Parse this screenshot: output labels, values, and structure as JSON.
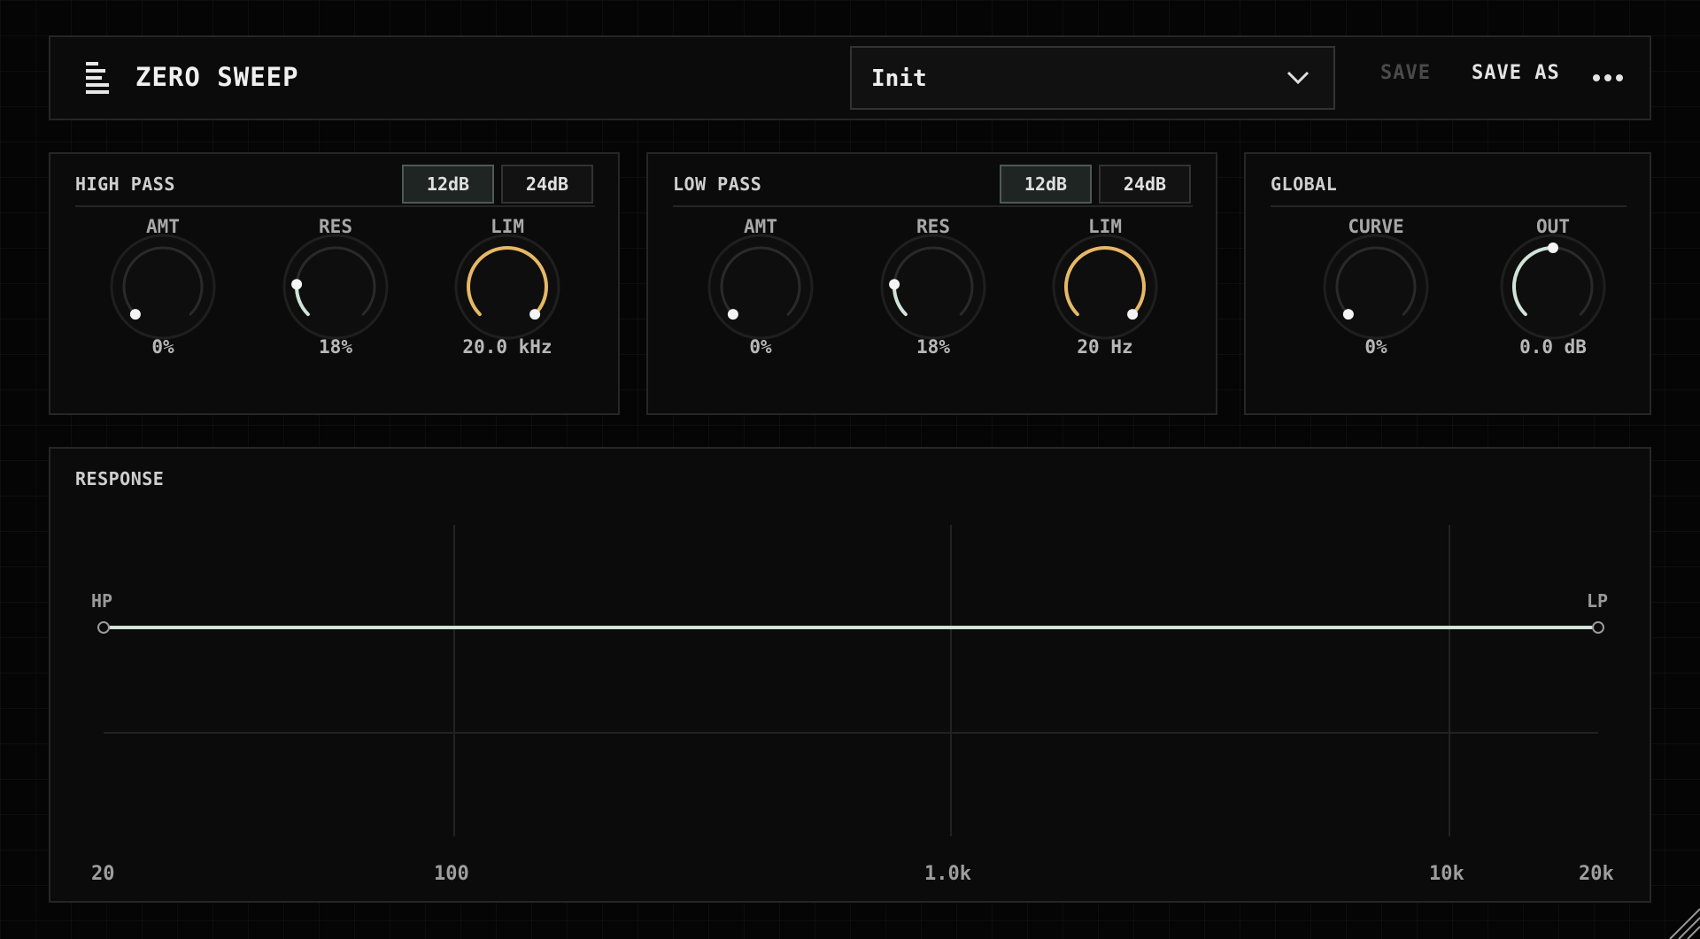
{
  "app": {
    "title": "ZERO SWEEP"
  },
  "header": {
    "preset_name": "Init",
    "save_label": "SAVE",
    "save_as_label": "SAVE AS"
  },
  "high_pass": {
    "title": "HIGH PASS",
    "slope_options": [
      "12dB",
      "24dB"
    ],
    "selected_slope": "12dB",
    "knobs": {
      "amt": {
        "label": "AMT",
        "value": "0%",
        "level": 0.0
      },
      "res": {
        "label": "RES",
        "value": "18%",
        "level": 0.18
      },
      "lim": {
        "label": "LIM",
        "value": "20.0 kHz",
        "level": 1.0
      }
    }
  },
  "low_pass": {
    "title": "LOW PASS",
    "slope_options": [
      "12dB",
      "24dB"
    ],
    "selected_slope": "12dB",
    "knobs": {
      "amt": {
        "label": "AMT",
        "value": "0%",
        "level": 0.0
      },
      "res": {
        "label": "RES",
        "value": "18%",
        "level": 0.18
      },
      "lim": {
        "label": "LIM",
        "value": "20 Hz",
        "level": 1.0
      }
    }
  },
  "global": {
    "title": "GLOBAL",
    "knobs": {
      "curve": {
        "label": "CURVE",
        "value": "0%",
        "level": 0.0
      },
      "out": {
        "label": "OUT",
        "value": "0.0 dB",
        "level": 0.5
      }
    }
  },
  "response": {
    "title": "RESPONSE",
    "hp_label": "HP",
    "lp_label": "LP",
    "freq_ticks": [
      "20",
      "100",
      "1.0k",
      "10k",
      "20k"
    ]
  },
  "colors": {
    "accent_gold": "#e6b866",
    "accent_mint": "#cfe3d6",
    "knob_track": "#2a2a2a"
  },
  "icons": {
    "logo": "stacked-bars-icon",
    "chevron": "chevron-down-icon",
    "more": "more-horizontal-icon"
  }
}
